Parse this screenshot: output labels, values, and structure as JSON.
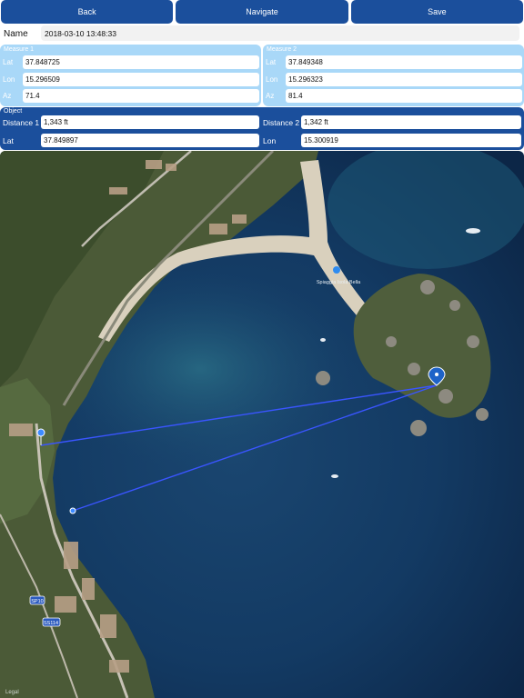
{
  "toolbar": {
    "back_label": "Back",
    "navigate_label": "Navigate",
    "save_label": "Save"
  },
  "name": {
    "label": "Name",
    "value": "2018-03-10 13:48:33"
  },
  "measure1": {
    "title": "Measure 1",
    "lat_label": "Lat",
    "lat": "37.848725",
    "lon_label": "Lon",
    "lon": "15.296509",
    "az_label": "Az",
    "az": "71.4"
  },
  "measure2": {
    "title": "Measure 2",
    "lat_label": "Lat",
    "lat": "37.849348",
    "lon_label": "Lon",
    "lon": "15.296323",
    "az_label": "Az",
    "az": "81.4"
  },
  "object": {
    "title": "Object",
    "distance1_label": "Distance 1",
    "distance1": "1,343 ft",
    "distance2_label": "Distance 2",
    "distance2": "1,342 ft",
    "lat_label": "Lat",
    "lat": "37.849897",
    "lon_label": "Lon",
    "lon": "15.300919"
  },
  "map": {
    "beach_label": "Spiaggia Isola Bella",
    "road_labels": [
      "SP10",
      "SS114"
    ],
    "legal_label": "Legal",
    "colors": {
      "sea_deep": "#0f2d55",
      "sea_shallow": "#1f5b7a",
      "land": "#4a5a36",
      "beach": "#d8cfbd",
      "bearing_line": "#3a55ff",
      "toolbar": "#1b4f9c",
      "measure_panel": "#a9d8f8"
    },
    "icons": [
      "pin-icon",
      "info-marker-icon"
    ]
  }
}
